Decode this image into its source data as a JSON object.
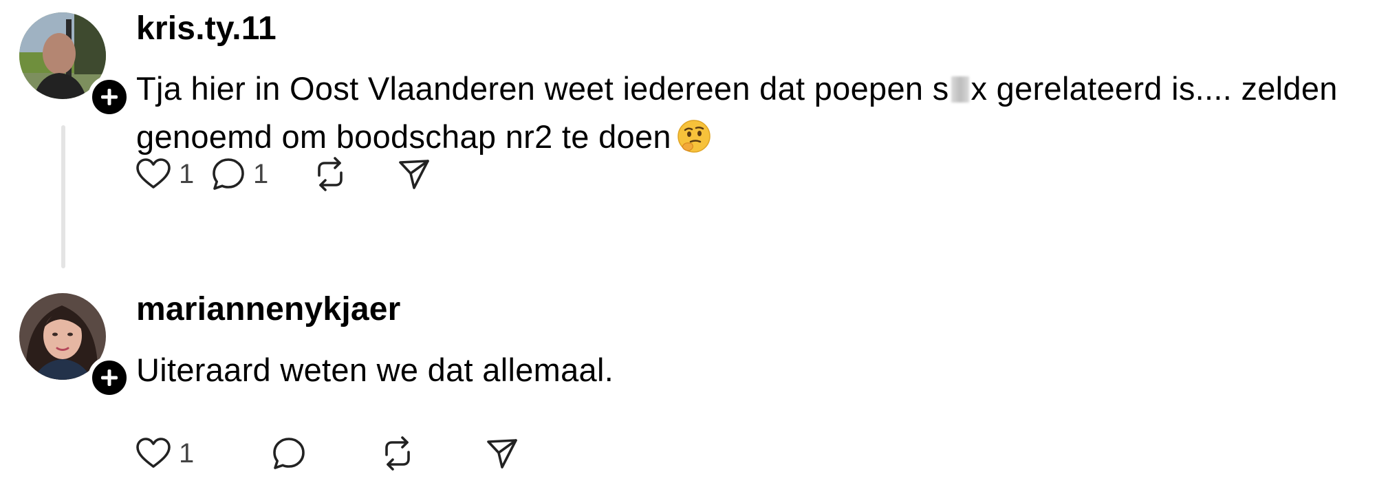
{
  "posts": [
    {
      "username": "kris.ty.11",
      "text_before": "Tja hier in Oost Vlaanderen weet iedereen dat poepen s",
      "text_after": "x gerelateerd is.... zelden genoemd om boodschap nr2 te doen",
      "emoji": "thinking-face",
      "likes": "1",
      "replies": "1",
      "icons": [
        "heart-icon",
        "comment-icon",
        "repost-icon",
        "share-icon"
      ]
    },
    {
      "username": "mariannenykjaer",
      "text": "Uiteraard weten we dat allemaal.",
      "likes": "1",
      "icons": [
        "heart-icon",
        "comment-icon",
        "repost-icon",
        "share-icon"
      ]
    }
  ],
  "colors": {
    "text": "#000000",
    "count": "#444444",
    "thread_line": "#e4e4e4",
    "badge": "#000000"
  }
}
